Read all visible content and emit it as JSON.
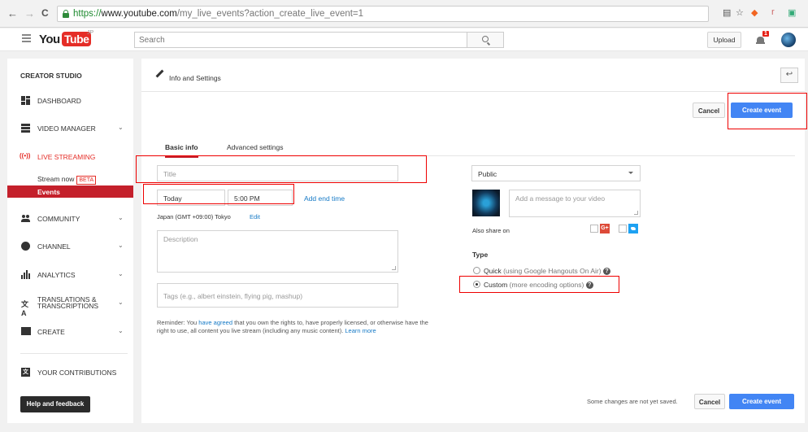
{
  "browser": {
    "back": "←",
    "forward": "→",
    "reload": "C",
    "url_scheme": "https://",
    "url_domain": "www.youtube.com",
    "url_path": "/my_live_events?action_create_live_event=1"
  },
  "header": {
    "logo_you": "You",
    "logo_tube": "Tube",
    "logo_region": "JP",
    "search_placeholder": "Search",
    "upload_label": "Upload",
    "notification_count": "1"
  },
  "sidebar": {
    "title": "CREATOR STUDIO",
    "items": {
      "dashboard": "DASHBOARD",
      "video_manager": "VIDEO MANAGER",
      "live_streaming": "LIVE STREAMING",
      "stream_now": "Stream now",
      "stream_now_badge": "BETA",
      "events": "Events",
      "community": "COMMUNITY",
      "channel": "CHANNEL",
      "analytics": "ANALYTICS",
      "translations_1": "TRANSLATIONS &",
      "translations_2": "TRANSCRIPTIONS",
      "create": "CREATE",
      "contributions": "YOUR CONTRIBUTIONS"
    },
    "live_icon": "((•))",
    "help_label": "Help and feedback"
  },
  "main": {
    "section_title": "Info and Settings",
    "back_icon": "↩",
    "cancel_label": "Cancel",
    "create_label": "Create event",
    "tabs": [
      "Basic info",
      "Advanced settings"
    ],
    "title_placeholder": "Title",
    "date_value": "Today",
    "time_value": "5:00 PM",
    "add_end_time": "Add end time",
    "timezone": "Japan (GMT +09:00) Tokyo",
    "timezone_edit": "Edit",
    "description_placeholder": "Description",
    "tags_placeholder": "Tags (e.g., albert einstein, flying pig, mashup)",
    "reminder_1": "Reminder: You ",
    "reminder_link": "have agreed",
    "reminder_2": " that you own the rights to, have properly licensed, or otherwise have the",
    "reminder_3": "right to use, all content you live stream (including any music content). ",
    "learn_more": "Learn more",
    "privacy_value": "Public",
    "message_placeholder": "Add a message to your video",
    "also_share": "Also share on",
    "gplus_label": "G+",
    "type_label": "Type",
    "type_quick": "Quick",
    "type_quick_desc": " (using Google Hangouts On Air)",
    "type_custom": "Custom",
    "type_custom_desc": " (more encoding options)",
    "unsaved_note": "Some changes are not yet saved.",
    "cancel_bottom": "Cancel",
    "create_bottom": "Create event"
  }
}
